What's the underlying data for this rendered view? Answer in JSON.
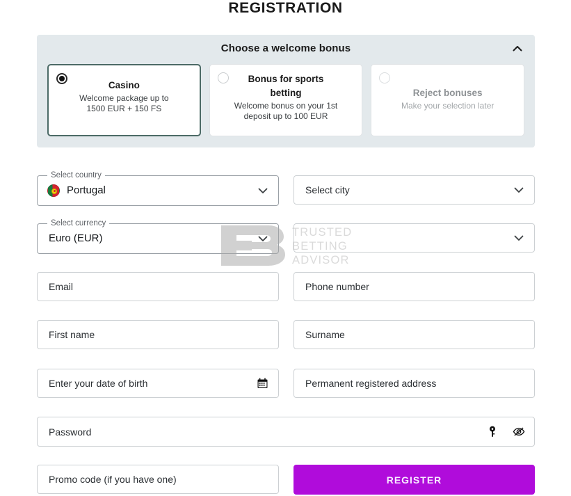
{
  "page_title": "REGISTRATION",
  "bonus_panel": {
    "title": "Choose a welcome bonus",
    "collapse_icon": "chevron-up-icon",
    "cards": [
      {
        "title": "Casino",
        "desc_line1": "Welcome package up to",
        "desc_line2": "1500 EUR + 150 FS",
        "selected": "true"
      },
      {
        "title_line1": "Bonus for sports",
        "title_line2": "betting",
        "desc_line1": "Welcome bonus on your 1st",
        "desc_line2": "deposit up to 100 EUR",
        "selected": "false"
      },
      {
        "title": "Reject bonuses",
        "desc_line1": "Make your selection later",
        "selected": "false"
      }
    ]
  },
  "fields": {
    "country": {
      "legend": "Select country",
      "value": "Portugal",
      "flag": "portugal-flag-icon",
      "chevron": "chevron-down-icon"
    },
    "city": {
      "placeholder": "Select city",
      "value": "",
      "chevron": "chevron-down-icon"
    },
    "currency": {
      "legend": "Select currency",
      "value": "Euro (EUR)",
      "chevron": "chevron-down-icon"
    },
    "extra_select": {
      "placeholder": "",
      "value": "",
      "chevron": "chevron-down-icon"
    },
    "email": {
      "placeholder": "Email",
      "value": ""
    },
    "phone": {
      "placeholder": "Phone number",
      "value": ""
    },
    "first_name": {
      "placeholder": "First name",
      "value": ""
    },
    "surname": {
      "placeholder": "Surname",
      "value": ""
    },
    "dob": {
      "placeholder": "Enter your date of birth",
      "value": "",
      "icon": "calendar-icon"
    },
    "address": {
      "placeholder": "Permanent registered address",
      "value": ""
    },
    "password": {
      "placeholder": "Password",
      "value": "",
      "icon_key": "key-icon",
      "icon_eye": "eye-off-icon"
    },
    "promo": {
      "placeholder": "Promo code (if you have one)",
      "value": ""
    }
  },
  "register_button": {
    "label": "REGISTER",
    "color": "#b00cdb"
  },
  "watermark": {
    "mark": "tb-logo-icon",
    "line1": "TRUSTED",
    "line2": "BETTING",
    "line3": "ADVISOR"
  }
}
